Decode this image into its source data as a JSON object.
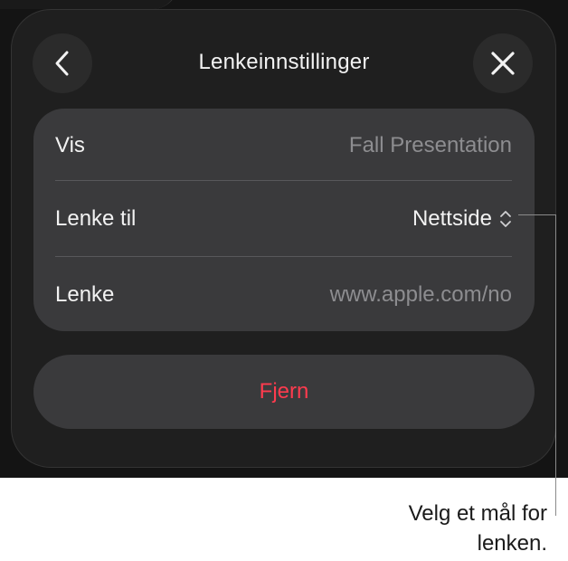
{
  "dialog": {
    "title": "Lenkeinnstillinger",
    "back_icon": "chevron-left-icon",
    "close_icon": "close-icon"
  },
  "rows": [
    {
      "label": "Vis",
      "value": "Fall Presentation"
    },
    {
      "label": "Lenke til",
      "value": "Nettside"
    },
    {
      "label": "Lenke",
      "value": "www.apple.com/no"
    }
  ],
  "remove_label": "Fjern",
  "callout": {
    "line1": "Velg et mål for",
    "line2": "lenken."
  },
  "colors": {
    "background": "#141414",
    "sheet": "#1f1f1f",
    "group": "#3a3a3c",
    "destructive": "#ff3b4e"
  }
}
